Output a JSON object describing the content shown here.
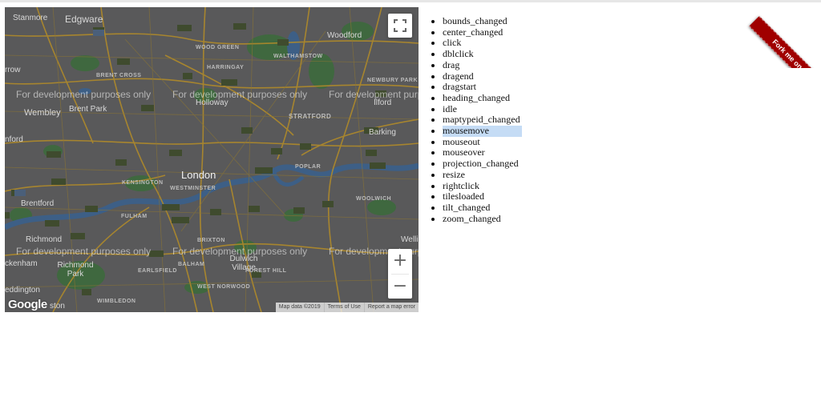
{
  "map": {
    "places": [
      {
        "text": "Stanmore",
        "kind": "town"
      },
      {
        "text": "Edgware",
        "kind": "town"
      },
      {
        "text": "Woodford",
        "kind": "town"
      },
      {
        "text": "WOOD GREEN",
        "kind": "area"
      },
      {
        "text": "WALTHAMSTOW",
        "kind": "area"
      },
      {
        "text": "HARRINGAY",
        "kind": "area"
      },
      {
        "text": "BRENT CROSS",
        "kind": "area"
      },
      {
        "text": "NEWBURY PARK",
        "kind": "area"
      },
      {
        "text": "Brent Park",
        "kind": "town"
      },
      {
        "text": "Holloway",
        "kind": "town"
      },
      {
        "text": "Ilford",
        "kind": "town"
      },
      {
        "text": "Wembley",
        "kind": "town"
      },
      {
        "text": "STRATFORD",
        "kind": "area"
      },
      {
        "text": "Barking",
        "kind": "town"
      },
      {
        "text": "London",
        "kind": "city"
      },
      {
        "text": "KENSINGTON",
        "kind": "area"
      },
      {
        "text": "WESTMINSTER",
        "kind": "area"
      },
      {
        "text": "POPLAR",
        "kind": "area"
      },
      {
        "text": "WOOLWICH",
        "kind": "area"
      },
      {
        "text": "Brentford",
        "kind": "town"
      },
      {
        "text": "FULHAM",
        "kind": "area"
      },
      {
        "text": "Richmond",
        "kind": "town"
      },
      {
        "text": "BRIXTON",
        "kind": "area"
      },
      {
        "text": "Dulwich Village",
        "kind": "town"
      },
      {
        "text": "FOREST HILL",
        "kind": "area"
      },
      {
        "text": "BALHAM",
        "kind": "area"
      },
      {
        "text": "EARLSFIELD",
        "kind": "area"
      },
      {
        "text": "ckenham",
        "kind": "town"
      },
      {
        "text": "Richmond Park",
        "kind": "town"
      },
      {
        "text": "WEST NORWOOD",
        "kind": "area"
      },
      {
        "text": "eddington",
        "kind": "town"
      },
      {
        "text": "WIMBLEDON",
        "kind": "area"
      },
      {
        "text": "ston",
        "kind": "town"
      },
      {
        "text": "Welli",
        "kind": "town"
      },
      {
        "text": "rrow",
        "kind": "town"
      },
      {
        "text": "nford",
        "kind": "town"
      }
    ],
    "dev_watermark": "For development purposes only",
    "fullscreen_label": "Toggle fullscreen view",
    "zoom_in": "+",
    "zoom_out": "−",
    "logo_text": "Google",
    "attribution": {
      "map_data": "Map data ©2019",
      "terms": "Terms of Use",
      "report": "Report a map error"
    },
    "colors": {
      "land": "#59595a",
      "road": "#b08a2a",
      "water": "#3d5f86",
      "park": "#3b6b3b"
    }
  },
  "events": [
    {
      "name": "bounds_changed",
      "active": false
    },
    {
      "name": "center_changed",
      "active": false
    },
    {
      "name": "click",
      "active": false
    },
    {
      "name": "dblclick",
      "active": false
    },
    {
      "name": "drag",
      "active": false
    },
    {
      "name": "dragend",
      "active": false
    },
    {
      "name": "dragstart",
      "active": false
    },
    {
      "name": "heading_changed",
      "active": false
    },
    {
      "name": "idle",
      "active": false
    },
    {
      "name": "maptypeid_changed",
      "active": false
    },
    {
      "name": "mousemove",
      "active": true
    },
    {
      "name": "mouseout",
      "active": false
    },
    {
      "name": "mouseover",
      "active": false
    },
    {
      "name": "projection_changed",
      "active": false
    },
    {
      "name": "resize",
      "active": false
    },
    {
      "name": "rightclick",
      "active": false
    },
    {
      "name": "tilesloaded",
      "active": false
    },
    {
      "name": "tilt_changed",
      "active": false
    },
    {
      "name": "zoom_changed",
      "active": false
    }
  ],
  "ribbon": {
    "text": "Fork me on GitHub",
    "color": "#a00000"
  }
}
